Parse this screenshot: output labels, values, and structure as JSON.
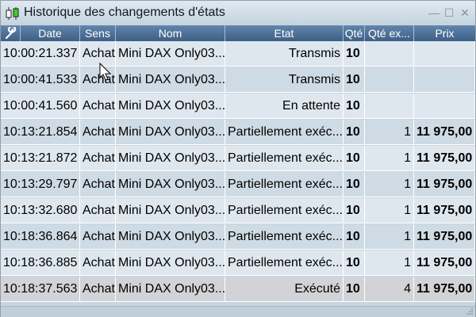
{
  "window": {
    "title": "Historique des changements d'états",
    "minimize_label": "—",
    "maximize_label": "☐",
    "close_label": "✕"
  },
  "columns": [
    "Date",
    "Sens",
    "Nom",
    "Etat",
    "Qté",
    "Qté ex...",
    "Prix"
  ],
  "rows": [
    {
      "date": "10:00:21.337",
      "sens": "Achat",
      "nom": "Mini DAX Only03...",
      "etat": "Transmis",
      "qte": "10",
      "qte_ex": "",
      "prix": ""
    },
    {
      "date": "10:00:41.533",
      "sens": "Achat",
      "nom": "Mini DAX Only03...",
      "etat": "Transmis",
      "qte": "10",
      "qte_ex": "",
      "prix": ""
    },
    {
      "date": "10:00:41.560",
      "sens": "Achat",
      "nom": "Mini DAX Only03...",
      "etat": "En attente",
      "qte": "10",
      "qte_ex": "",
      "prix": ""
    },
    {
      "date": "10:13:21.854",
      "sens": "Achat",
      "nom": "Mini DAX Only03...",
      "etat": "Partiellement exéc...",
      "qte": "10",
      "qte_ex": "1",
      "prix": "11 975,00"
    },
    {
      "date": "10:13:21.872",
      "sens": "Achat",
      "nom": "Mini DAX Only03...",
      "etat": "Partiellement exéc...",
      "qte": "10",
      "qte_ex": "1",
      "prix": "11 975,00"
    },
    {
      "date": "10:13:29.797",
      "sens": "Achat",
      "nom": "Mini DAX Only03...",
      "etat": "Partiellement exéc...",
      "qte": "10",
      "qte_ex": "1",
      "prix": "11 975,00"
    },
    {
      "date": "10:13:32.680",
      "sens": "Achat",
      "nom": "Mini DAX Only03...",
      "etat": "Partiellement exéc...",
      "qte": "10",
      "qte_ex": "1",
      "prix": "11 975,00"
    },
    {
      "date": "10:18:36.864",
      "sens": "Achat",
      "nom": "Mini DAX Only03...",
      "etat": "Partiellement exéc...",
      "qte": "10",
      "qte_ex": "1",
      "prix": "11 975,00"
    },
    {
      "date": "10:18:36.885",
      "sens": "Achat",
      "nom": "Mini DAX Only03...",
      "etat": "Partiellement exéc...",
      "qte": "10",
      "qte_ex": "1",
      "prix": "11 975,00"
    },
    {
      "date": "10:18:37.563",
      "sens": "Achat",
      "nom": "Mini DAX Only03...",
      "etat": "Exécuté",
      "qte": "10",
      "qte_ex": "4",
      "prix": "11 975,00"
    }
  ],
  "colors": {
    "header_bg": "#4d6f96",
    "row_light": "#dfe7ee",
    "row_dark": "#cfdbe4",
    "icon_green": "#3bd12b"
  }
}
